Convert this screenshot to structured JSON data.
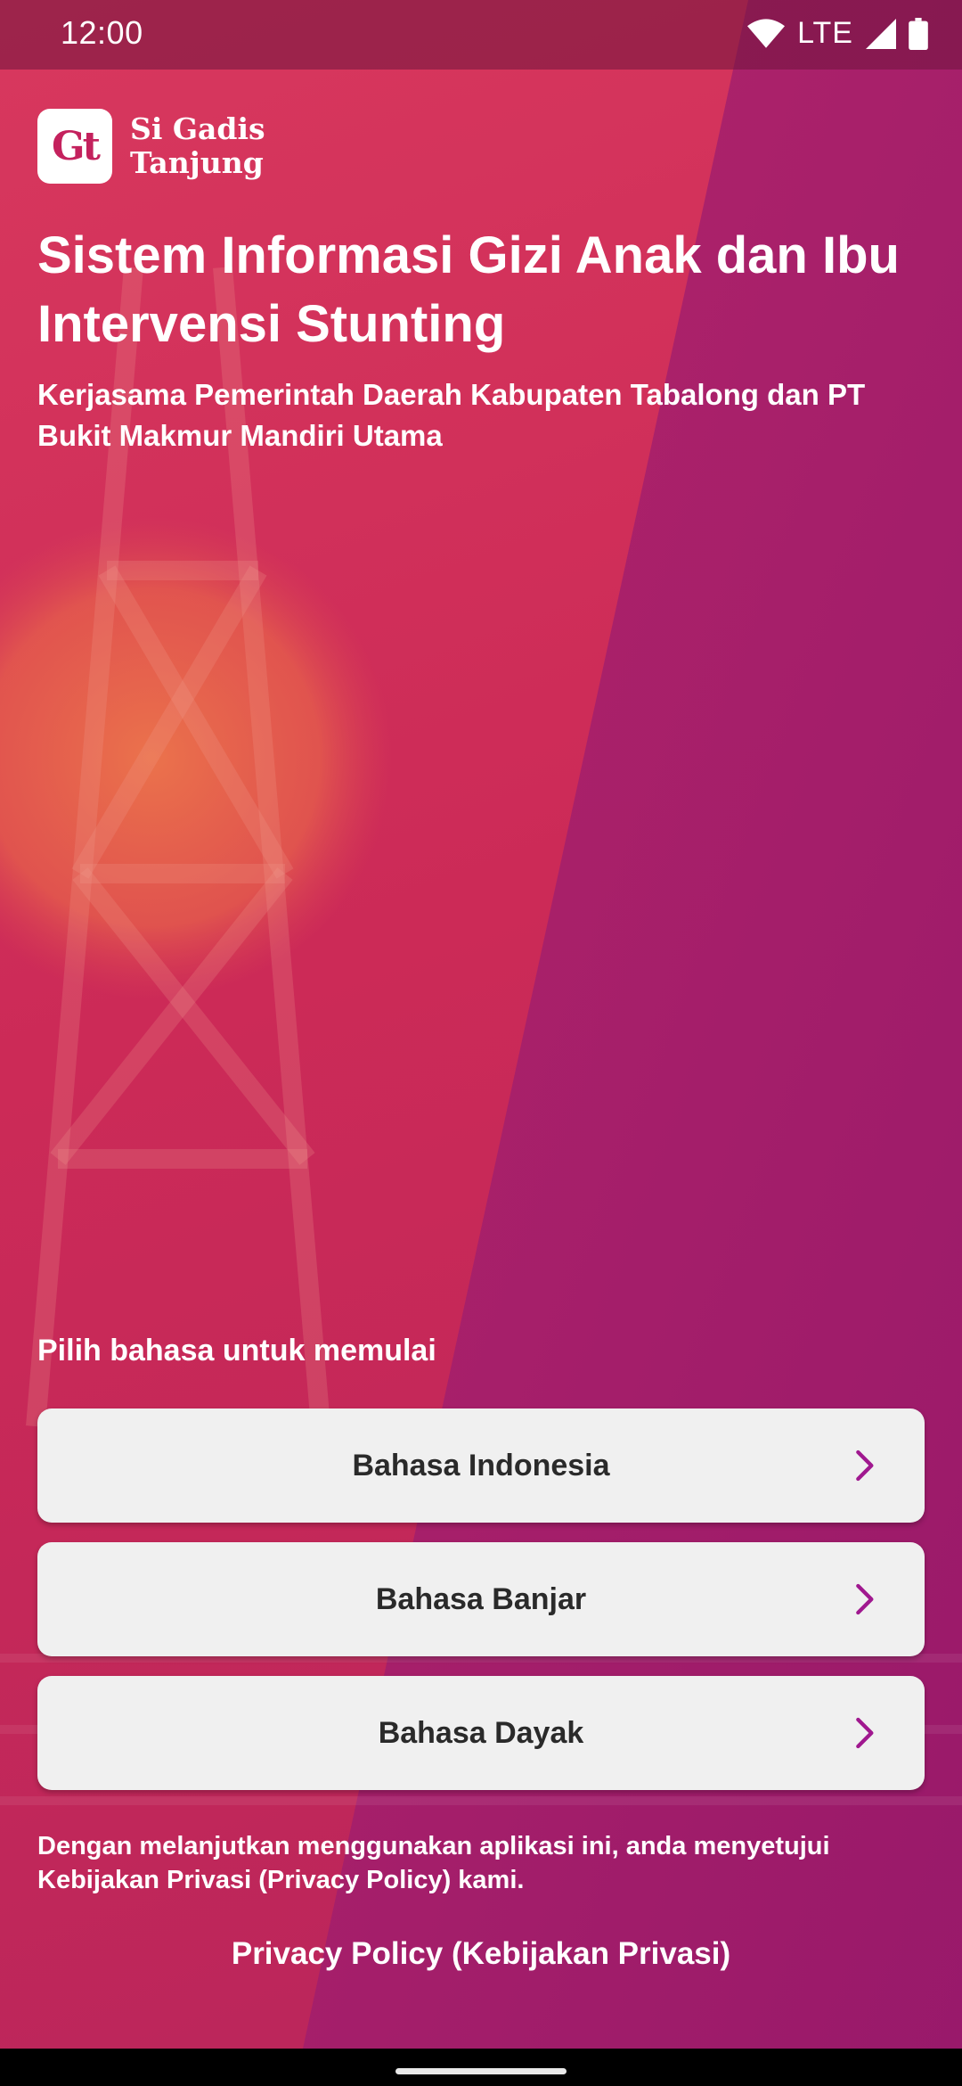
{
  "status_bar": {
    "time": "12:00",
    "network": "LTE",
    "icons": [
      "wifi-icon",
      "cell-signal-icon",
      "battery-icon"
    ]
  },
  "brand": {
    "logo_text": "Gt",
    "name": "Si Gadis\nTanjung"
  },
  "hero": {
    "title": "Sistem Informasi Gizi Anak dan Ibu Intervensi Stunting",
    "subtitle": "Kerjasama Pemerintah Daerah Kabupaten Tabalong dan PT Bukit Makmur Mandiri Utama"
  },
  "language_select": {
    "prompt": "Pilih bahasa untuk memulai",
    "options": [
      {
        "label": "Bahasa Indonesia",
        "icon": "chevron-right-icon"
      },
      {
        "label": "Bahasa Banjar",
        "icon": "chevron-right-icon"
      },
      {
        "label": "Bahasa Dayak",
        "icon": "chevron-right-icon"
      }
    ]
  },
  "footer": {
    "consent_text": "Dengan melanjutkan menggunakan aplikasi ini, anda menyetujui Kebijakan Privasi (Privacy Policy) kami.",
    "privacy_link": "Privacy Policy (Kebijakan Privasi)"
  },
  "colors": {
    "accent": "#a0188f",
    "background_red": "#cc2a57",
    "background_magenta": "#a01e6e",
    "button_bg": "#f0f0f0"
  }
}
